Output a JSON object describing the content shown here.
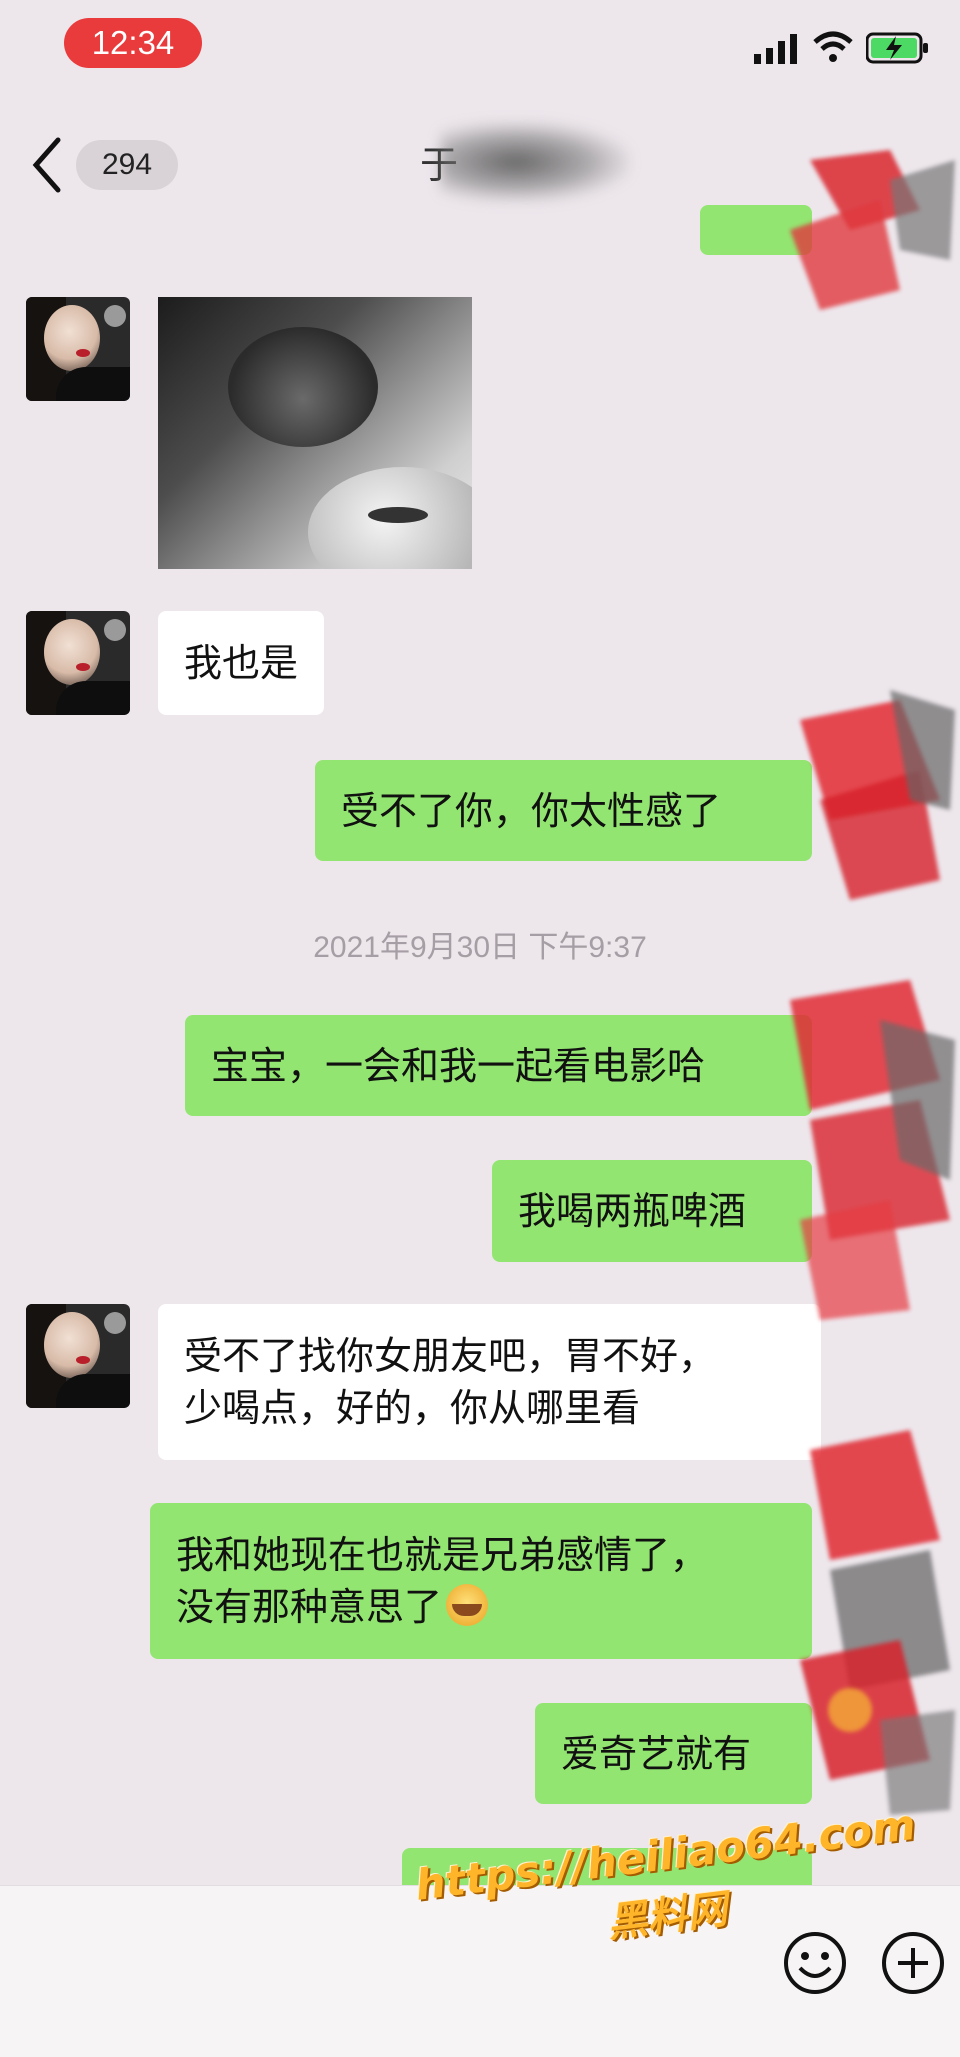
{
  "status_bar": {
    "time": "12:34"
  },
  "nav": {
    "back_label": "<",
    "unread_count": "294",
    "contact_name": "于"
  },
  "timestamp": "2021年9月30日 下午9:37",
  "messages": [
    {
      "side": "in",
      "text": "我也是"
    },
    {
      "side": "out",
      "text": "受不了你，你太性感了"
    },
    {
      "side": "out",
      "text": "宝宝，一会和我一起看电影哈"
    },
    {
      "side": "out",
      "text": "我喝两瓶啤酒"
    },
    {
      "side": "in",
      "text": "受不了找你女朋友吧，胃不好，\n少喝点，好的，你从哪里看"
    },
    {
      "side": "out",
      "text": "我和她现在也就是兄弟感情了，\n没有那种意思了"
    },
    {
      "side": "out",
      "text": "爱奇艺就有"
    }
  ],
  "watermark": {
    "url": "https://heiliao64.com",
    "site": "黑料网"
  },
  "colors": {
    "out_bubble": "#93e571",
    "in_bubble": "#ffffff",
    "background": "#ede7ec",
    "time_pill": "#e93a3c"
  }
}
